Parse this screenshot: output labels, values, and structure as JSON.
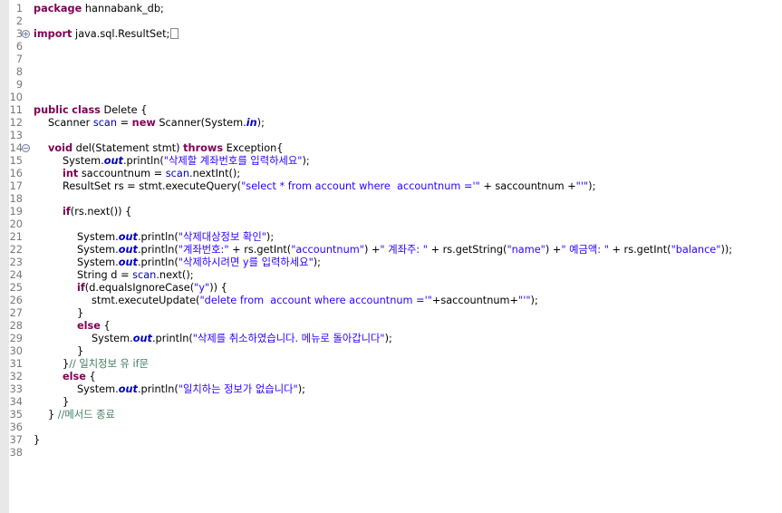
{
  "editor": {
    "lines": [
      {
        "n": "1",
        "fold": "",
        "i": 0,
        "t": [
          [
            "kw",
            "package"
          ],
          [
            "p",
            " hannabank_db;"
          ]
        ]
      },
      {
        "n": "2",
        "fold": "",
        "i": 0,
        "t": []
      },
      {
        "n": "3",
        "fold": "+",
        "i": 0,
        "t": [
          [
            "kw",
            "import"
          ],
          [
            "p",
            " java.sql.ResultSet;"
          ],
          [
            "box",
            ""
          ]
        ]
      },
      {
        "n": "6",
        "fold": "",
        "i": 0,
        "t": []
      },
      {
        "n": "7",
        "fold": "",
        "i": 0,
        "t": []
      },
      {
        "n": "8",
        "fold": "",
        "i": 0,
        "t": []
      },
      {
        "n": "9",
        "fold": "",
        "i": 0,
        "t": []
      },
      {
        "n": "10",
        "fold": "",
        "i": 0,
        "t": []
      },
      {
        "n": "11",
        "fold": "",
        "i": 0,
        "t": [
          [
            "kw",
            "public"
          ],
          [
            "p",
            " "
          ],
          [
            "kw",
            "class"
          ],
          [
            "p",
            " Delete {"
          ]
        ]
      },
      {
        "n": "12",
        "fold": "",
        "i": 1,
        "t": [
          [
            "p",
            "Scanner "
          ],
          [
            "fld",
            "scan"
          ],
          [
            "p",
            " = "
          ],
          [
            "kw",
            "new"
          ],
          [
            "p",
            " Scanner(System."
          ],
          [
            "sfld",
            "in"
          ],
          [
            "p",
            ");"
          ]
        ]
      },
      {
        "n": "13",
        "fold": "",
        "i": 0,
        "t": []
      },
      {
        "n": "14",
        "fold": "-",
        "i": 1,
        "t": [
          [
            "kw",
            "void"
          ],
          [
            "p",
            " del(Statement stmt) "
          ],
          [
            "kw",
            "throws"
          ],
          [
            "p",
            " Exception{"
          ]
        ]
      },
      {
        "n": "15",
        "fold": "",
        "i": 2,
        "t": [
          [
            "p",
            "System."
          ],
          [
            "sfld",
            "out"
          ],
          [
            "p",
            ".println("
          ],
          [
            "str",
            "\"삭제할 계좌번호를 입력하세요\""
          ],
          [
            "p",
            ");"
          ]
        ]
      },
      {
        "n": "16",
        "fold": "",
        "i": 2,
        "t": [
          [
            "kw",
            "int"
          ],
          [
            "p",
            " saccountnum = "
          ],
          [
            "fld",
            "scan"
          ],
          [
            "p",
            ".nextInt();"
          ]
        ]
      },
      {
        "n": "17",
        "fold": "",
        "i": 2,
        "t": [
          [
            "p",
            "ResultSet rs = stmt.executeQuery("
          ],
          [
            "str",
            "\"select * from account where  accountnum ='\""
          ],
          [
            "p",
            " + saccountnum +"
          ],
          [
            "str",
            "\"'\""
          ],
          [
            "p",
            ");"
          ]
        ]
      },
      {
        "n": "18",
        "fold": "",
        "i": 0,
        "t": []
      },
      {
        "n": "19",
        "fold": "",
        "i": 2,
        "t": [
          [
            "kw",
            "if"
          ],
          [
            "p",
            "(rs.next()) {"
          ]
        ]
      },
      {
        "n": "20",
        "fold": "",
        "i": 0,
        "t": []
      },
      {
        "n": "21",
        "fold": "",
        "i": 3,
        "t": [
          [
            "p",
            "System."
          ],
          [
            "sfld",
            "out"
          ],
          [
            "p",
            ".println("
          ],
          [
            "str",
            "\"삭제대상정보 확인\""
          ],
          [
            "p",
            ");"
          ]
        ]
      },
      {
        "n": "22",
        "fold": "",
        "i": 3,
        "t": [
          [
            "p",
            "System."
          ],
          [
            "sfld",
            "out"
          ],
          [
            "p",
            ".println("
          ],
          [
            "str",
            "\"계좌번호:\""
          ],
          [
            "p",
            " + rs.getInt("
          ],
          [
            "str",
            "\"accountnum\""
          ],
          [
            "p",
            ") +"
          ],
          [
            "str",
            "\" 계좌주: \""
          ],
          [
            "p",
            " + rs.getString("
          ],
          [
            "str",
            "\"name\""
          ],
          [
            "p",
            ") +"
          ],
          [
            "str",
            "\" 예금액: \""
          ],
          [
            "p",
            " + rs.getInt("
          ],
          [
            "str",
            "\"balance\""
          ],
          [
            "p",
            "));"
          ]
        ]
      },
      {
        "n": "23",
        "fold": "",
        "i": 3,
        "t": [
          [
            "p",
            "System."
          ],
          [
            "sfld",
            "out"
          ],
          [
            "p",
            ".println("
          ],
          [
            "str",
            "\"삭제하시려면 y를 입력하세요\""
          ],
          [
            "p",
            ");"
          ]
        ]
      },
      {
        "n": "24",
        "fold": "",
        "i": 3,
        "t": [
          [
            "p",
            "String d = "
          ],
          [
            "fld",
            "scan"
          ],
          [
            "p",
            ".next();"
          ]
        ]
      },
      {
        "n": "25",
        "fold": "",
        "i": 3,
        "t": [
          [
            "kw",
            "if"
          ],
          [
            "p",
            "(d.equalsIgnoreCase("
          ],
          [
            "str",
            "\"y\""
          ],
          [
            "p",
            ")) {"
          ]
        ]
      },
      {
        "n": "26",
        "fold": "",
        "i": 4,
        "t": [
          [
            "p",
            "stmt.executeUpdate("
          ],
          [
            "str",
            "\"delete from  account where accountnum ='\""
          ],
          [
            "p",
            "+saccountnum+"
          ],
          [
            "str",
            "\"'\""
          ],
          [
            "p",
            ");"
          ]
        ]
      },
      {
        "n": "27",
        "fold": "",
        "i": 3,
        "t": [
          [
            "p",
            "}"
          ]
        ]
      },
      {
        "n": "28",
        "fold": "",
        "i": 3,
        "t": [
          [
            "kw",
            "else"
          ],
          [
            "p",
            " {"
          ]
        ]
      },
      {
        "n": "29",
        "fold": "",
        "i": 4,
        "t": [
          [
            "p",
            "System."
          ],
          [
            "sfld",
            "out"
          ],
          [
            "p",
            ".println("
          ],
          [
            "str",
            "\"삭제를 취소하였습니다. 메뉴로 돌아갑니다\""
          ],
          [
            "p",
            ");"
          ]
        ]
      },
      {
        "n": "30",
        "fold": "",
        "i": 3,
        "t": [
          [
            "p",
            "}"
          ]
        ]
      },
      {
        "n": "31",
        "fold": "",
        "i": 2,
        "t": [
          [
            "p",
            "}"
          ],
          [
            "cmt",
            "// 일치정보 유 if문"
          ]
        ]
      },
      {
        "n": "32",
        "fold": "",
        "i": 2,
        "t": [
          [
            "kw",
            "else"
          ],
          [
            "p",
            " {"
          ]
        ]
      },
      {
        "n": "33",
        "fold": "",
        "i": 3,
        "t": [
          [
            "p",
            "System."
          ],
          [
            "sfld",
            "out"
          ],
          [
            "p",
            ".println("
          ],
          [
            "str",
            "\"일치하는 정보가 없습니다\""
          ],
          [
            "p",
            ");"
          ]
        ]
      },
      {
        "n": "34",
        "fold": "",
        "i": 2,
        "t": [
          [
            "p",
            "}"
          ]
        ]
      },
      {
        "n": "35",
        "fold": "",
        "i": 1,
        "t": [
          [
            "p",
            "} "
          ],
          [
            "cmt",
            "//메서드 종료"
          ]
        ]
      },
      {
        "n": "36",
        "fold": "",
        "i": 0,
        "t": []
      },
      {
        "n": "37",
        "fold": "",
        "i": 0,
        "t": [
          [
            "p",
            "}"
          ]
        ]
      },
      {
        "n": "38",
        "fold": "",
        "i": 0,
        "t": []
      }
    ]
  }
}
